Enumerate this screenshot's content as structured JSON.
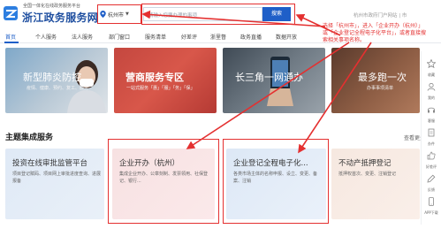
{
  "header": {
    "logo_subtitle": "全国一体化在线政务服务平台",
    "logo_title": "浙江政务服务网",
    "city": "杭州市",
    "search_placeholder": "请输入您要办理的事项",
    "search_button": "搜索",
    "portal_link": "杭州市政府门户网站 | 市"
  },
  "nav": [
    "首页",
    "个人服务",
    "法人服务",
    "部门窗口",
    "服务清单",
    "好差评",
    "浙里督",
    "政务直播",
    "数据开放"
  ],
  "annotation": "选择「杭州市」，进入「企业开办（杭州）」或「企业登记全程电子化平台」，或者直接搜索相关事项名称。",
  "banners": [
    {
      "title": "新型肺炎防控",
      "subtitle": "疫情、健康、预约、复工、服务"
    },
    {
      "title": "营商服务专区",
      "subtitle": "一站式服务「惠」「服」「务」「保」"
    },
    {
      "title": "长三角一网通办",
      "subtitle": ""
    },
    {
      "title": "最多跑一次",
      "subtitle": "办事事项清单"
    }
  ],
  "section": {
    "title": "主题集成服务",
    "more": "查看更多"
  },
  "cards": [
    {
      "title": "投资在线审批监管平台",
      "desc": "项目登记赋码、项目网上审批进度查询、进展报备"
    },
    {
      "title": "企业开办（杭州）",
      "desc": "集成企业开办、公章刻制、发票领用、社保登记、银行..."
    },
    {
      "title": "企业登记全程电子化...",
      "desc": "各类市场主体的名称申报、设立、变更、备案、注销"
    },
    {
      "title": "不动产抵押登记",
      "desc": "抵押权首次、变更、注销登记"
    }
  ],
  "rail": [
    "收藏",
    "我的",
    "客服",
    "办件",
    "好差评",
    "反馈",
    "APP下载"
  ],
  "colors": {
    "accent": "#1f5fc8",
    "highlight": "#e43030"
  }
}
